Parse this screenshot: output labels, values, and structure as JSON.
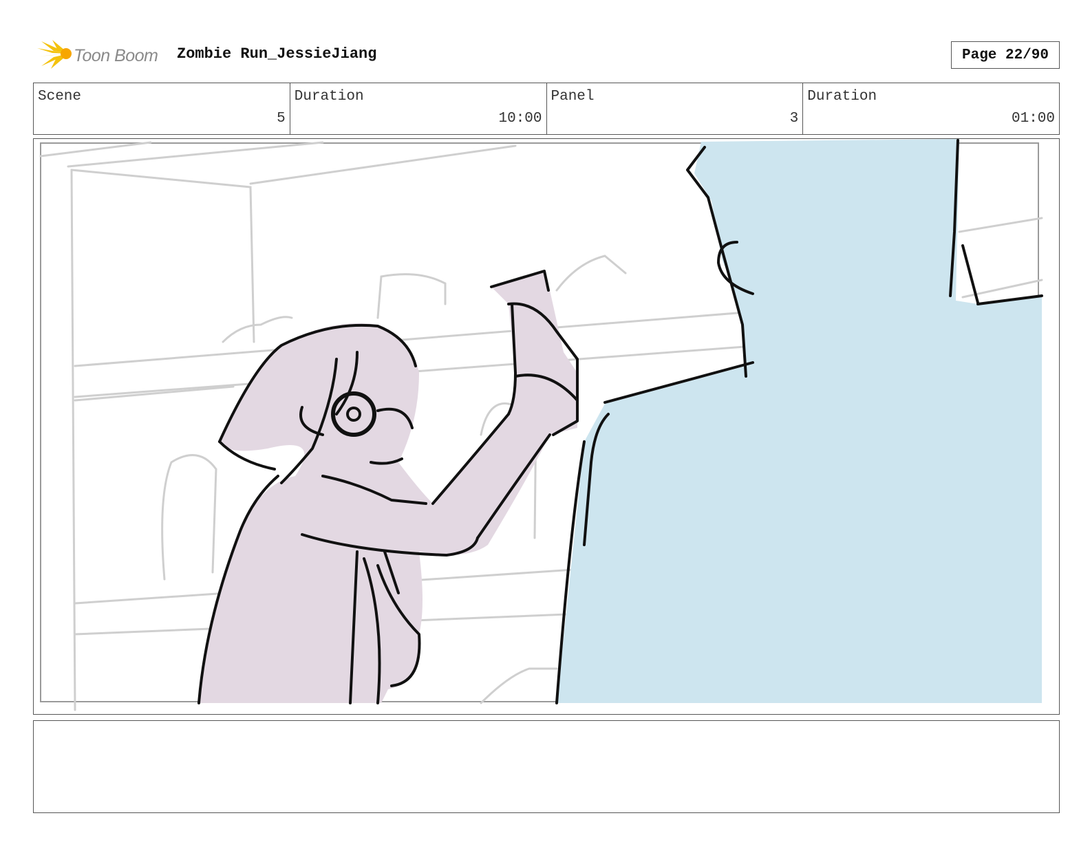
{
  "header": {
    "logo_text": "Toon Boom",
    "project_title": "Zombie Run_JessieJiang",
    "page_label": "Page 22/90"
  },
  "info": {
    "scene_label": "Scene",
    "scene_value": "5",
    "scene_duration_label": "Duration",
    "scene_duration_value": "10:00",
    "panel_label": "Panel",
    "panel_value": "3",
    "panel_duration_label": "Duration",
    "panel_duration_value": "01:00"
  },
  "colors": {
    "girl_fill": "#e3d8e2",
    "zombie_fill": "#cde5ef",
    "line": "#111111",
    "background_sketch": "#cfcfcf"
  },
  "notes": {
    "text": ""
  }
}
